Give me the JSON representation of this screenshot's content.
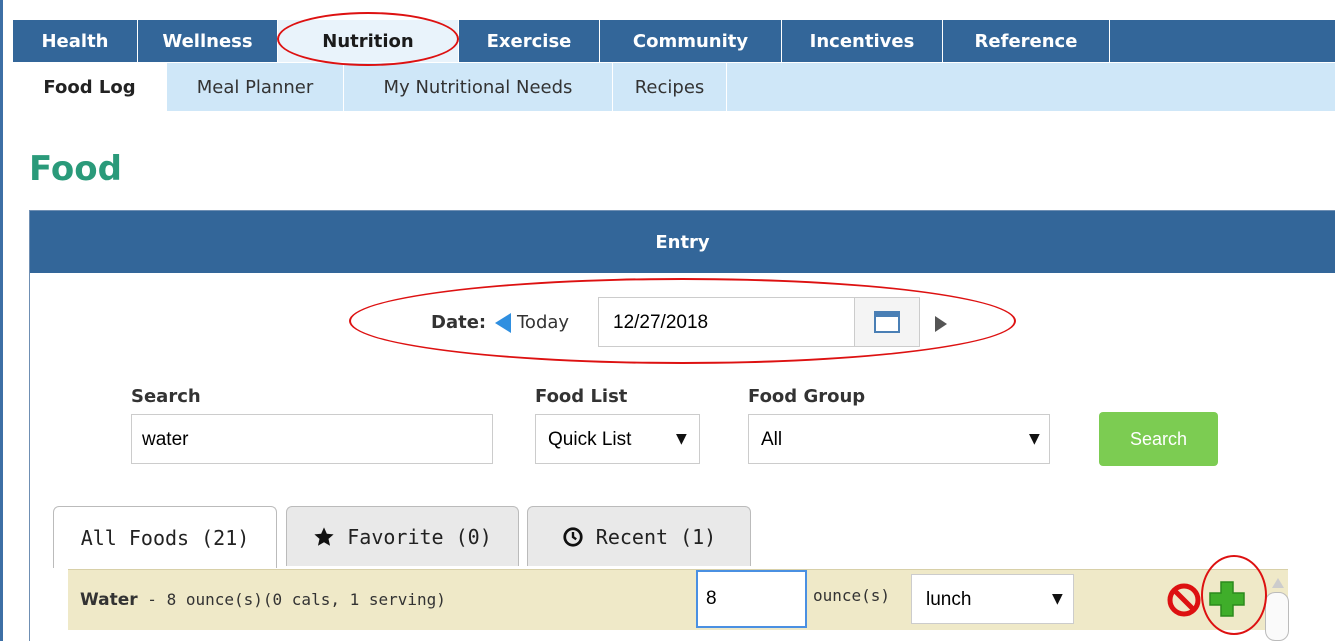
{
  "topnav": {
    "tabs": [
      {
        "label": "Health"
      },
      {
        "label": "Wellness"
      },
      {
        "label": "Nutrition",
        "active": true
      },
      {
        "label": "Exercise"
      },
      {
        "label": "Community"
      },
      {
        "label": "Incentives"
      },
      {
        "label": "Reference"
      }
    ]
  },
  "subnav": {
    "tabs": [
      {
        "label": "Food Log",
        "active": true
      },
      {
        "label": "Meal Planner"
      },
      {
        "label": "My Nutritional Needs"
      },
      {
        "label": "Recipes"
      }
    ]
  },
  "page": {
    "title": "Food"
  },
  "entry": {
    "header": "Entry",
    "date_label": "Date:",
    "today_label": "Today",
    "date_value": "12/27/2018"
  },
  "search": {
    "search_label": "Search",
    "search_value": "water",
    "food_list_label": "Food List",
    "food_list_value": "Quick List",
    "food_group_label": "Food Group",
    "food_group_value": "All",
    "button_label": "Search"
  },
  "food_tabs": [
    {
      "label": "All Foods (21)",
      "active": true
    },
    {
      "label": "Favorite (0)",
      "icon": "star-icon"
    },
    {
      "label": "Recent (1)",
      "icon": "clock-icon"
    }
  ],
  "food_row": {
    "name": "Water",
    "description": " - 8 ounce(s)(0 cals, 1 serving)",
    "quantity": "8",
    "unit": "ounce(s)",
    "meal": "lunch"
  },
  "colors": {
    "nav_blue": "#336699",
    "subnav_blue": "#cfe7f8",
    "title_green": "#2a9a7a",
    "button_green": "#7ccc52",
    "row_tan": "#efe9c8",
    "annotation_red": "#dd1111"
  }
}
